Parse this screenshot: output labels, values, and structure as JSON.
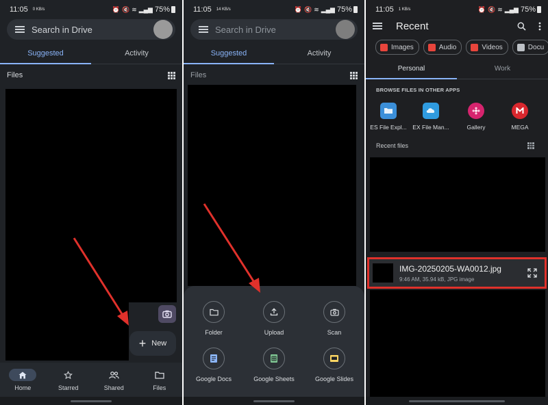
{
  "status_bars": [
    {
      "time": "11:05",
      "mini": "0 KB/s",
      "battery": "75%"
    },
    {
      "time": "11:05",
      "mini": "14 KB/s",
      "battery": "75%"
    },
    {
      "time": "11:05",
      "mini": "1 KB/s",
      "battery": "75%"
    }
  ],
  "drive": {
    "search_placeholder": "Search in Drive",
    "tabs": [
      "Suggested",
      "Activity"
    ],
    "files_label": "Files",
    "new_fab_label": "New",
    "bottom_nav": [
      {
        "label": "Home",
        "icon": "home-icon"
      },
      {
        "label": "Starred",
        "icon": "star-icon"
      },
      {
        "label": "Shared",
        "icon": "people-icon"
      },
      {
        "label": "Files",
        "icon": "folder-icon"
      }
    ]
  },
  "create_sheet": {
    "items": [
      {
        "label": "Folder",
        "icon": "folder-icon"
      },
      {
        "label": "Upload",
        "icon": "upload-icon"
      },
      {
        "label": "Scan",
        "icon": "camera-icon"
      },
      {
        "label": "Google Docs",
        "icon": "docs-icon",
        "color": "#8ab4f8"
      },
      {
        "label": "Google Sheets",
        "icon": "sheets-icon",
        "color": "#81c995"
      },
      {
        "label": "Google Slides",
        "icon": "slides-icon",
        "color": "#fdd663"
      }
    ]
  },
  "picker": {
    "title": "Recent",
    "chips": [
      {
        "label": "Images",
        "color": "#e8453c"
      },
      {
        "label": "Audio",
        "color": "#e8453c"
      },
      {
        "label": "Videos",
        "color": "#e8453c"
      },
      {
        "label": "Docu",
        "color": "#bdc1c6"
      }
    ],
    "tabs": [
      "Personal",
      "Work"
    ],
    "browse_label": "BROWSE FILES IN OTHER APPS",
    "apps": [
      {
        "label": "ES File Expl...",
        "icon": "es-file-explorer-icon",
        "color": "#3b8fd9"
      },
      {
        "label": "EX File Man...",
        "icon": "ex-file-manager-icon",
        "color": "#2f9be0"
      },
      {
        "label": "Gallery",
        "icon": "gallery-icon",
        "color": "#d6246e"
      },
      {
        "label": "MEGA",
        "icon": "mega-icon",
        "color": "#d9272e"
      }
    ],
    "recent_files_label": "Recent files",
    "file": {
      "name": "IMG-20250205-WA0012.jpg",
      "meta": "9:46 AM, 35.94 kB, JPG image"
    }
  },
  "colors": {
    "accent": "#8ab4f8",
    "arrow": "#e0312b",
    "highlight_border": "#e0312b"
  }
}
